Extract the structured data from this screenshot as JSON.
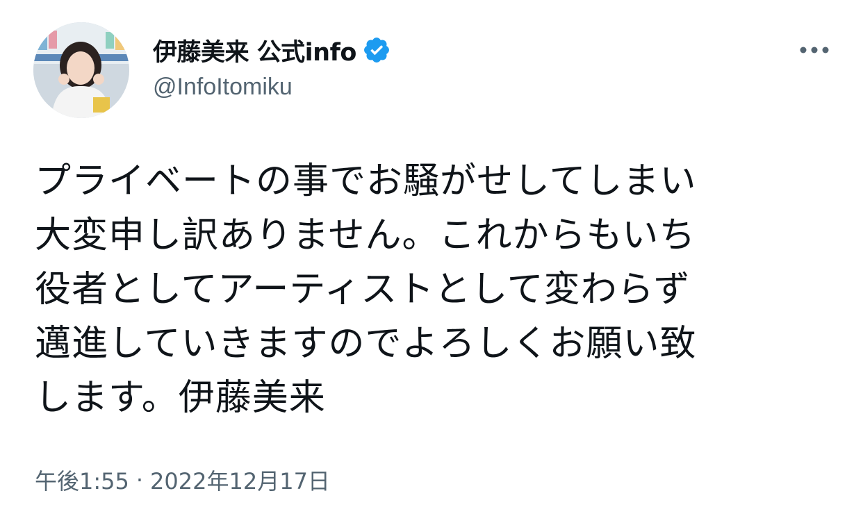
{
  "tweet": {
    "author": {
      "display_name": "伊藤美来 公式info",
      "handle": "@InfoItomiku",
      "verified": true
    },
    "text_lines": [
      "プライベートの事でお騒がせしてしまい",
      "大変申し訳ありません。これからもいち",
      "役者としてアーティストとして変わらず",
      "邁進していきますのでよろしくお願い致",
      "します。伊藤美来"
    ],
    "time": "午後1:55",
    "separator": "·",
    "date": "2022年12月17日"
  },
  "colors": {
    "text_primary": "#0f1419",
    "text_secondary": "#536471",
    "verified_blue": "#1d9bf0"
  },
  "icons": {
    "verified": "verified-badge-icon",
    "more": "more-horizontal-icon"
  }
}
